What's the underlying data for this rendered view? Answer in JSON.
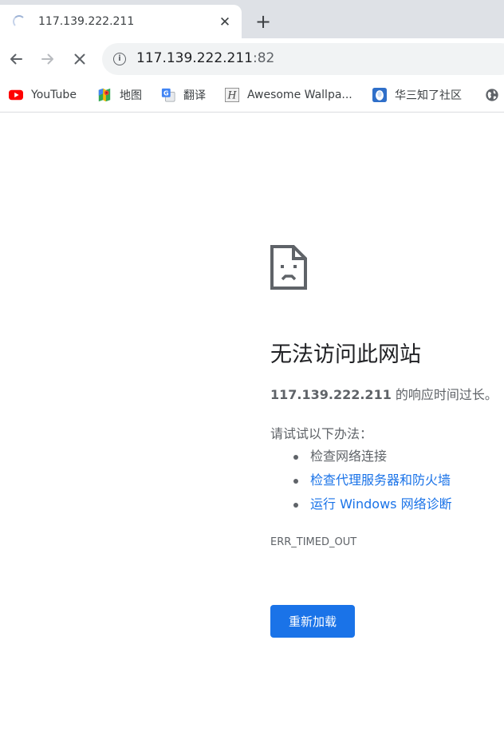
{
  "tab": {
    "title": "117.139.222.211",
    "close_glyph": "✕",
    "state": "loading"
  },
  "new_tab_glyph": "+",
  "toolbar": {
    "back_icon": "arrow-left-icon",
    "forward_icon": "arrow-right-icon",
    "stop_icon": "stop-x-icon",
    "info_glyph": "i",
    "url_host": "117.139.222.211",
    "url_port": ":82"
  },
  "bookmarks": [
    {
      "label": "YouTube",
      "icon": "youtube-icon"
    },
    {
      "label": "地图",
      "icon": "maps-icon"
    },
    {
      "label": "翻译",
      "icon": "translate-icon"
    },
    {
      "label": "Awesome Wallpa...",
      "icon": "wallpaper-icon"
    },
    {
      "label": "华三知了社区",
      "icon": "h3c-icon"
    },
    {
      "label": "",
      "icon": "globe-icon"
    }
  ],
  "error": {
    "icon": "sad-page-icon",
    "heading": "无法访问此网站",
    "host": "117.139.222.211",
    "summary_suffix": " 的响应时间过长。",
    "try_label": "请试试以下办法：",
    "suggestions": [
      {
        "text": "检查网络连接",
        "is_link": false
      },
      {
        "text": "检查代理服务器和防火墙",
        "is_link": true
      },
      {
        "text": "运行 Windows 网络诊断",
        "is_link": true
      }
    ],
    "code": "ERR_TIMED_OUT",
    "reload_label": "重新加载"
  },
  "colors": {
    "accent": "#1a73e8",
    "tabstrip": "#dee1e6",
    "omnibox": "#f1f3f4",
    "text_secondary": "#5f6368"
  }
}
